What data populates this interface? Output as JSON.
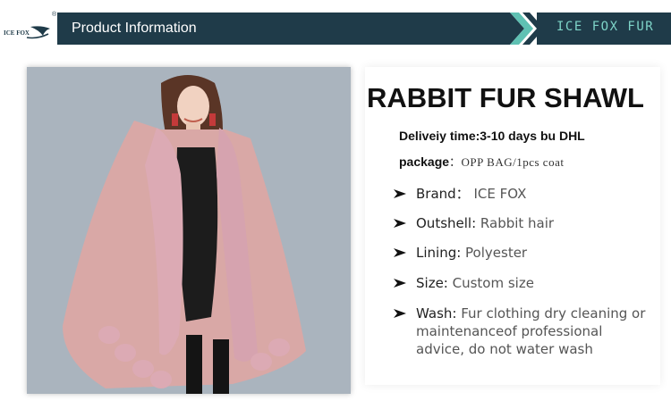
{
  "header": {
    "logo_text": "ICE FOX",
    "logo_reg": "®",
    "title": "Product Information",
    "brand_right": "ICE FOX FUR"
  },
  "product": {
    "image": "model-wearing-pink-rabbit-fur-shawl",
    "title": "RABBIT FUR SHAWL",
    "delivery": "Deliveiy time:3-10 days bu DHL",
    "package_label": "package",
    "package_value": "：OPP BAG/1pcs coat"
  },
  "specs": [
    {
      "label": "Brand：",
      "value": " ICE FOX"
    },
    {
      "label": "Outshell:",
      "value": " Rabbit hair"
    },
    {
      "label": "Lining:",
      "value": " Polyester"
    },
    {
      "label": "Size:",
      "value": " Custom size"
    },
    {
      "label": "Wash:",
      "value": " Fur clothing dry cleaning or maintenanceof professional advice, do not water wash"
    }
  ],
  "colors": {
    "header_bg": "#1f3b49",
    "accent_teal": "#7ed4c8",
    "shawl_pink": "#d9a8a6",
    "fur_pink": "#dcaab4"
  }
}
